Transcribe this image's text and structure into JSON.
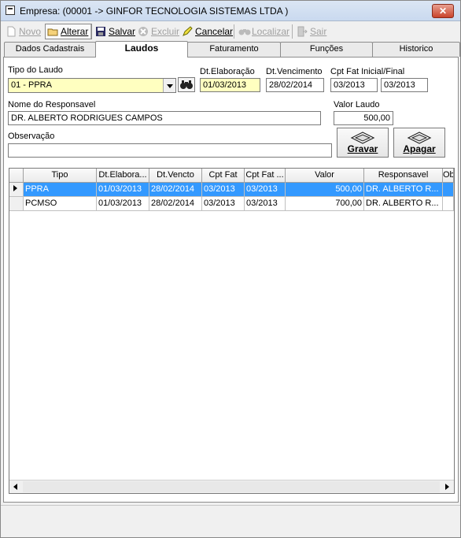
{
  "window": {
    "title": "Empresa: (00001 -> GINFOR TECNOLOGIA SISTEMAS LTDA )"
  },
  "toolbar": {
    "novo": "Novo",
    "alterar": "Alterar",
    "salvar": "Salvar",
    "excluir": "Excluir",
    "cancelar": "Cancelar",
    "localizar": "Localizar",
    "sair": "Sair"
  },
  "tabs": [
    "Dados Cadastrais",
    "Laudos",
    "Faturamento",
    "Funções",
    "Historico"
  ],
  "form": {
    "tipo_label": "Tipo do Laudo",
    "tipo_value": "01 - PPRA",
    "dt_elab_label": "Dt.Elaboração",
    "dt_elab_value": "01/03/2013",
    "dt_venc_label": "Dt.Vencimento",
    "dt_venc_value": "28/02/2014",
    "cpt_label": "Cpt Fat Inicial/Final",
    "cpt_ini_value": "03/2013",
    "cpt_fim_value": "03/2013",
    "resp_label": "Nome do Responsavel",
    "resp_value": "DR. ALBERTO RODRIGUES CAMPOS",
    "valor_label": "Valor Laudo",
    "valor_value": "500,00",
    "obs_label": "Observação",
    "obs_value": "",
    "gravar": "Gravar",
    "apagar": "Apagar"
  },
  "grid": {
    "columns": [
      "Tipo",
      "Dt.Elabora...",
      "Dt.Vencto",
      "Cpt Fat",
      "Cpt Fat ...",
      "Valor",
      "Responsavel",
      "Obs"
    ],
    "rows": [
      [
        "PPRA",
        "01/03/2013",
        "28/02/2014",
        "03/2013",
        "03/2013",
        "500,00",
        "DR. ALBERTO R...",
        ""
      ],
      [
        "PCMSO",
        "01/03/2013",
        "28/02/2014",
        "03/2013",
        "03/2013",
        "700,00",
        "DR. ALBERTO R...",
        ""
      ]
    ]
  },
  "colors": {
    "selection": "#3399ff",
    "required_field": "#ffffc0"
  }
}
